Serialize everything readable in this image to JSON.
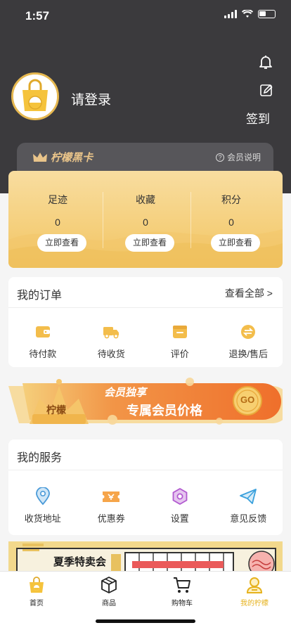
{
  "status_bar": {
    "time": "1:57"
  },
  "header": {
    "login_text": "请登录",
    "signin_label": "签到",
    "bell_icon": "bell-icon",
    "edit_icon": "edit-icon"
  },
  "black_card": {
    "title": "柠檬黑卡",
    "info_label": "会员说明",
    "colors": {
      "bg": "#57565a",
      "gold": "#e9c48a"
    }
  },
  "stats": [
    {
      "label": "足迹",
      "value": "0",
      "button": "立即查看"
    },
    {
      "label": "收藏",
      "value": "0",
      "button": "立即查看"
    },
    {
      "label": "积分",
      "value": "0",
      "button": "立即查看"
    }
  ],
  "orders": {
    "title": "我的订单",
    "more": "查看全部 >",
    "items": [
      {
        "label": "待付款",
        "icon": "wallet-icon"
      },
      {
        "label": "待收货",
        "icon": "truck-icon"
      },
      {
        "label": "评价",
        "icon": "review-icon"
      },
      {
        "label": "退换/售后",
        "icon": "exchange-icon"
      }
    ]
  },
  "member_banner": {
    "badge": "柠檬",
    "tag": "会员独享",
    "title": "专属会员价格",
    "coin": "GO"
  },
  "services": {
    "title": "我的服务",
    "items": [
      {
        "label": "收货地址",
        "icon": "location-icon"
      },
      {
        "label": "优惠券",
        "icon": "coupon-icon"
      },
      {
        "label": "设置",
        "icon": "settings-icon"
      },
      {
        "label": "意见反馈",
        "icon": "feedback-icon"
      }
    ]
  },
  "promo": {
    "title": "夏季特卖会"
  },
  "tabbar": [
    {
      "label": "首页",
      "icon": "home-bag-icon"
    },
    {
      "label": "商品",
      "icon": "box-icon"
    },
    {
      "label": "购物车",
      "icon": "cart-icon"
    },
    {
      "label": "我的柠檬",
      "icon": "user-icon",
      "active": true
    }
  ],
  "colors": {
    "accent": "#f0c160",
    "dark_header": "#3b3a3d",
    "active_tab": "#e6b21e"
  }
}
